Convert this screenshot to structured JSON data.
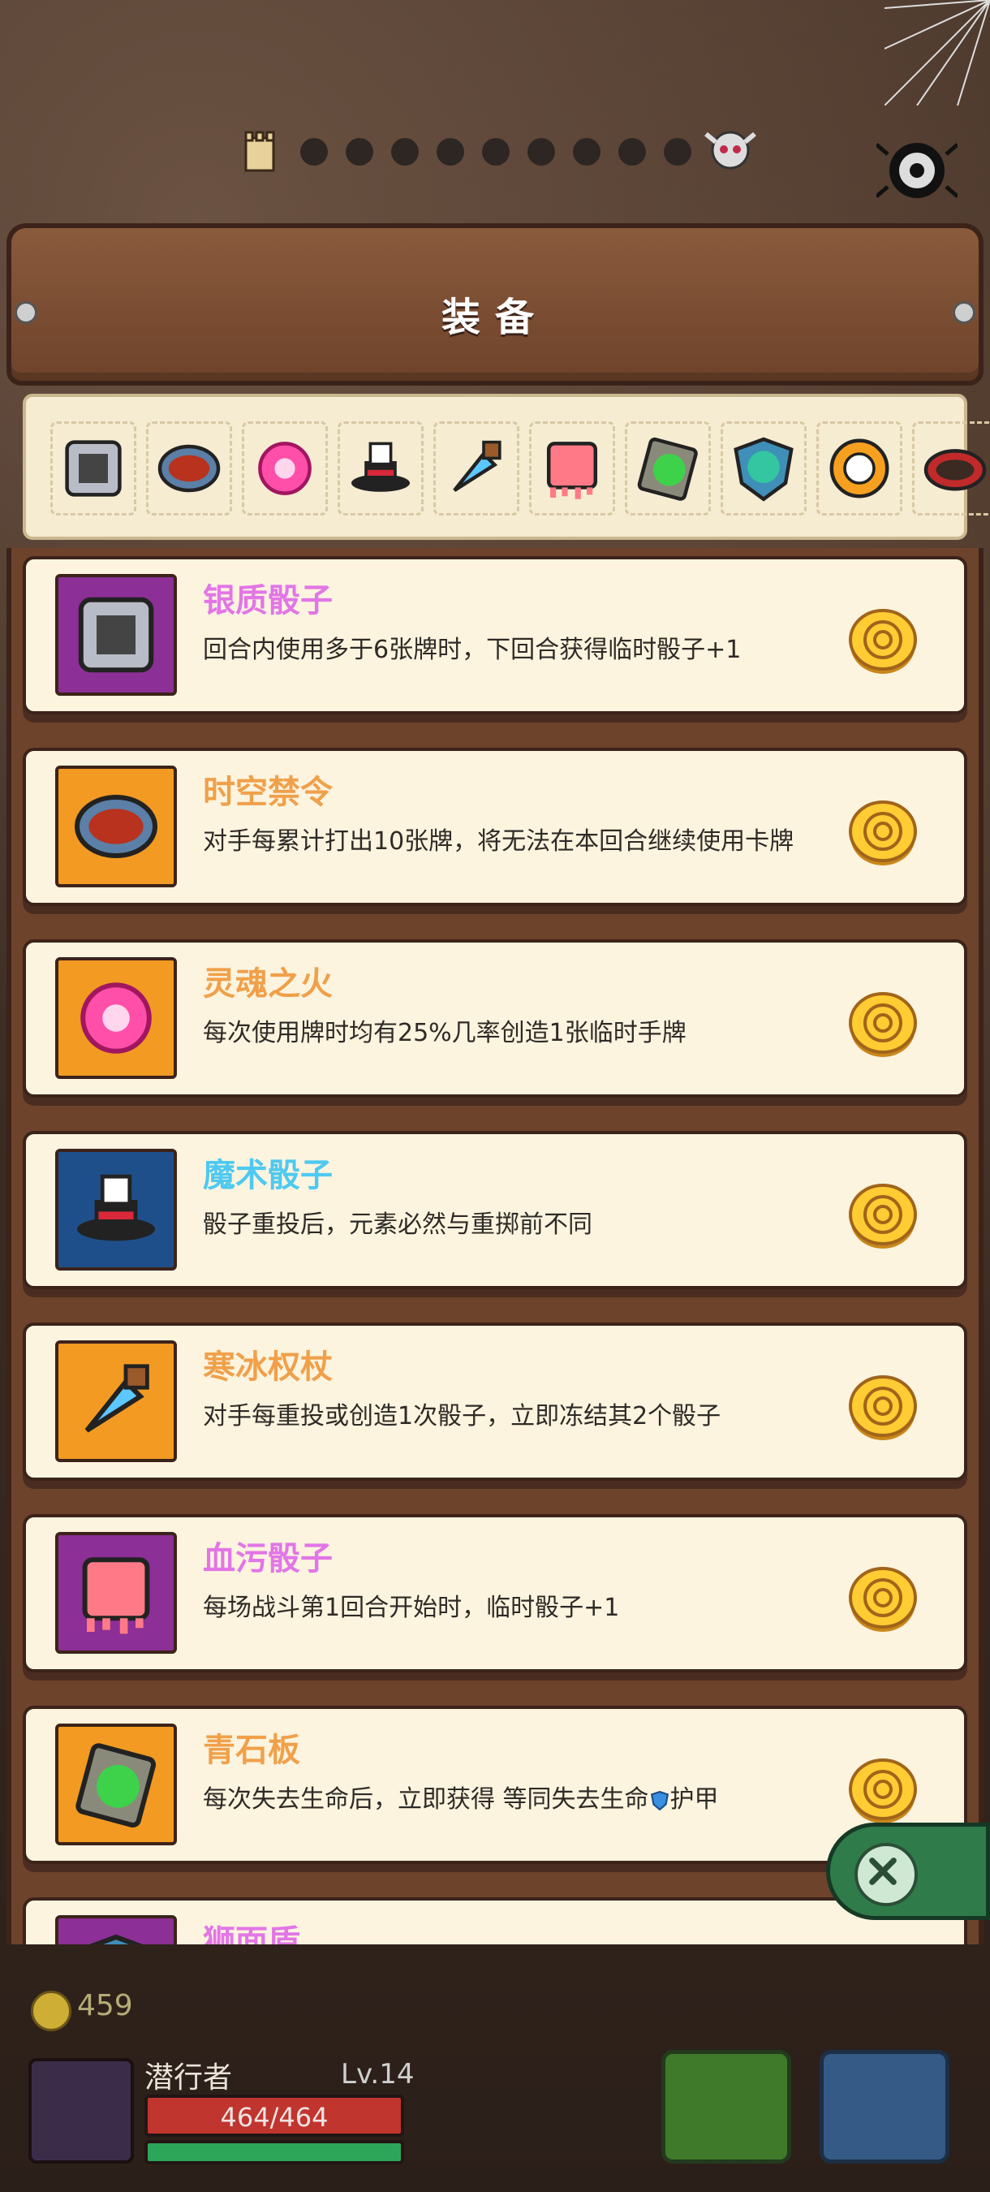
{
  "header": {
    "title": "装备"
  },
  "strip": {
    "icons": [
      "silver-dice-icon",
      "time-ban-icon",
      "soul-fire-icon",
      "magic-dice-icon",
      "ice-scepter-icon",
      "blood-dice-icon",
      "green-slab-icon",
      "lion-shield-icon",
      "ring-icon",
      "spiked-collar-icon"
    ]
  },
  "items": [
    {
      "name": "银质骰子",
      "desc": "回合内使用多于6张牌时，下回合获得临时骰子+1",
      "name_color": "#e276e6",
      "bg": "#8c2f96",
      "icon": "silver-dice-icon"
    },
    {
      "name": "时空禁令",
      "desc": "对手每累计打出10张牌，将无法在本回合继续使用卡牌",
      "name_color": "#f0a04a",
      "bg": "#f29a22",
      "icon": "time-ban-icon"
    },
    {
      "name": "灵魂之火",
      "desc": "每次使用牌时均有25%几率创造1张临时手牌",
      "name_color": "#f0a04a",
      "bg": "#f29a22",
      "icon": "soul-fire-icon"
    },
    {
      "name": "魔术骰子",
      "desc": "骰子重投后，元素必然与重掷前不同",
      "name_color": "#4fc9f0",
      "bg": "#1f4f8a",
      "icon": "magic-dice-icon"
    },
    {
      "name": "寒冰权杖",
      "desc": "对手每重投或创造1次骰子，立即冻结其2个骰子",
      "name_color": "#f0a04a",
      "bg": "#f29a22",
      "icon": "ice-scepter-icon"
    },
    {
      "name": "血污骰子",
      "desc": "每场战斗第1回合开始时，临时骰子+1",
      "name_color": "#e276e6",
      "bg": "#8c2f96",
      "icon": "blood-dice-icon"
    },
    {
      "name": "青石板",
      "desc": "每次失去生命后，立即获得 等同失去生命",
      "desc_suffix": "护甲",
      "name_color": "#f0a04a",
      "bg": "#f29a22",
      "icon": "green-slab-icon"
    },
    {
      "name": "狮面盾",
      "desc": "",
      "name_color": "#e276e6",
      "bg": "#8c2f96",
      "icon": "lion-shield-icon"
    }
  ],
  "hud": {
    "gold": "459",
    "player_name": "潜行者",
    "level": "Lv.14",
    "hp": "464/464"
  },
  "colors": {
    "wood": "#6e432b",
    "parchment": "#fcf4df",
    "purple": "#8c2f96",
    "orange": "#f29a22",
    "blue": "#1f4f8a"
  }
}
